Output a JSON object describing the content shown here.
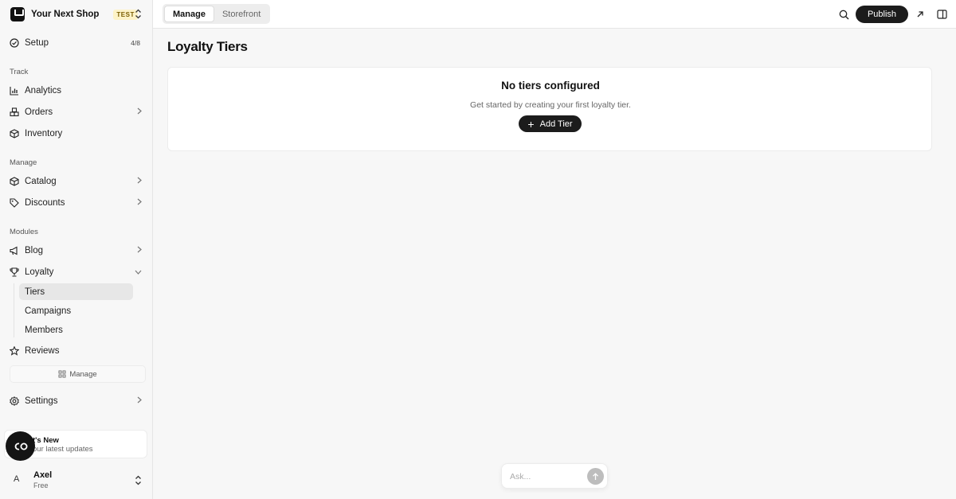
{
  "brand": {
    "name": "Your Next Shop",
    "badge": "TEST"
  },
  "sidebar": {
    "setup": {
      "label": "Setup",
      "progress": "4/8"
    },
    "sections": {
      "track": "Track",
      "manage": "Manage",
      "modules": "Modules"
    },
    "items": {
      "analytics": "Analytics",
      "orders": "Orders",
      "inventory": "Inventory",
      "catalog": "Catalog",
      "discounts": "Discounts",
      "blog": "Blog",
      "loyalty": "Loyalty",
      "reviews": "Reviews",
      "settings": "Settings"
    },
    "loyalty_sub": {
      "tiers": "Tiers",
      "campaigns": "Campaigns",
      "members": "Members"
    },
    "manage_button": "Manage",
    "whats_new": {
      "title": "t's New",
      "subtitle": "our latest updates"
    },
    "user": {
      "initial": "A",
      "name": "Axel",
      "plan": "Free"
    }
  },
  "topbar": {
    "tabs": {
      "manage": "Manage",
      "storefront": "Storefront"
    },
    "publish_label": "Publish"
  },
  "main": {
    "title": "Loyalty Tiers",
    "empty_state": {
      "title": "No tiers configured",
      "subtitle": "Get started by creating your first loyalty tier.",
      "button": "Add Tier"
    },
    "ask": {
      "placeholder": "Ask..."
    }
  },
  "colors": {
    "accent": "#1c1c1c",
    "badge_bg": "#fdf3c7",
    "active_bg": "#e7e7e7"
  }
}
